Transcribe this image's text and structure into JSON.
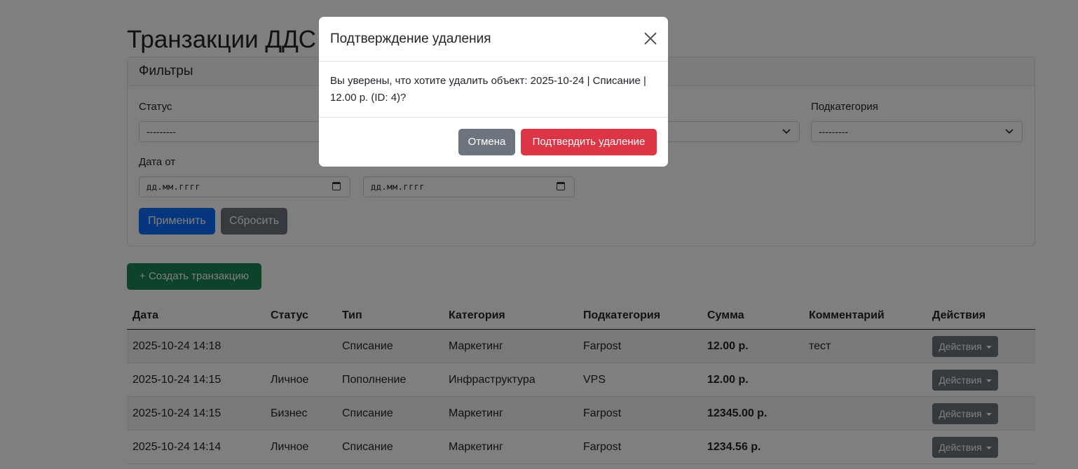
{
  "page": {
    "title": "Транзакции ДДС"
  },
  "filters": {
    "header": "Фильтры",
    "status": {
      "label": "Статус",
      "value": "---------"
    },
    "subcategory": {
      "label": "Подкатегория",
      "value": "---------"
    },
    "date_from": {
      "label": "Дата от",
      "placeholder": "дд.мм.гггг"
    },
    "date_to": {
      "placeholder": "дд.мм.гггг"
    },
    "apply_label": "Применить",
    "reset_label": "Сбросить"
  },
  "create_button_label": "+ Создать транзакцию",
  "table": {
    "headers": [
      "Дата",
      "Статус",
      "Тип",
      "Категория",
      "Подкатегория",
      "Сумма",
      "Комментарий",
      "Действия"
    ],
    "rows": [
      {
        "date": "2025-10-24 14:18",
        "status": "",
        "type": "Списание",
        "category": "Маркетинг",
        "subcategory": "Farpost",
        "amount": "12.00 р.",
        "comment": "тест",
        "actions": "Действия"
      },
      {
        "date": "2025-10-24 14:15",
        "status": "Личное",
        "type": "Пополнение",
        "category": "Инфраструктура",
        "subcategory": "VPS",
        "amount": "12.00 р.",
        "comment": "",
        "actions": "Действия"
      },
      {
        "date": "2025-10-24 14:15",
        "status": "Бизнес",
        "type": "Списание",
        "category": "Маркетинг",
        "subcategory": "Farpost",
        "amount": "12345.00 р.",
        "comment": "",
        "actions": "Действия"
      },
      {
        "date": "2025-10-24 14:14",
        "status": "Личное",
        "type": "Списание",
        "category": "Маркетинг",
        "subcategory": "Farpost",
        "amount": "1234.56 р.",
        "comment": "",
        "actions": "Действия"
      }
    ]
  },
  "modal": {
    "title": "Подтверждение удаления",
    "message": "Вы уверены, что хотите удалить объект: 2025-10-24 | Списание | 12.00 р. (ID: 4)?",
    "cancel_label": "Отмена",
    "confirm_label": "Подтвердить удаление"
  },
  "colors": {
    "primary": "#0d6efd",
    "secondary": "#6c757d",
    "success": "#198754",
    "danger": "#dc3545",
    "backdrop": "rgba(0,0,0,0.5)"
  },
  "icons": {
    "close": "close-icon",
    "select_chevron": "chevron-down-icon",
    "date_picker": "calendar-icon",
    "actions_caret": "caret-down-icon"
  }
}
